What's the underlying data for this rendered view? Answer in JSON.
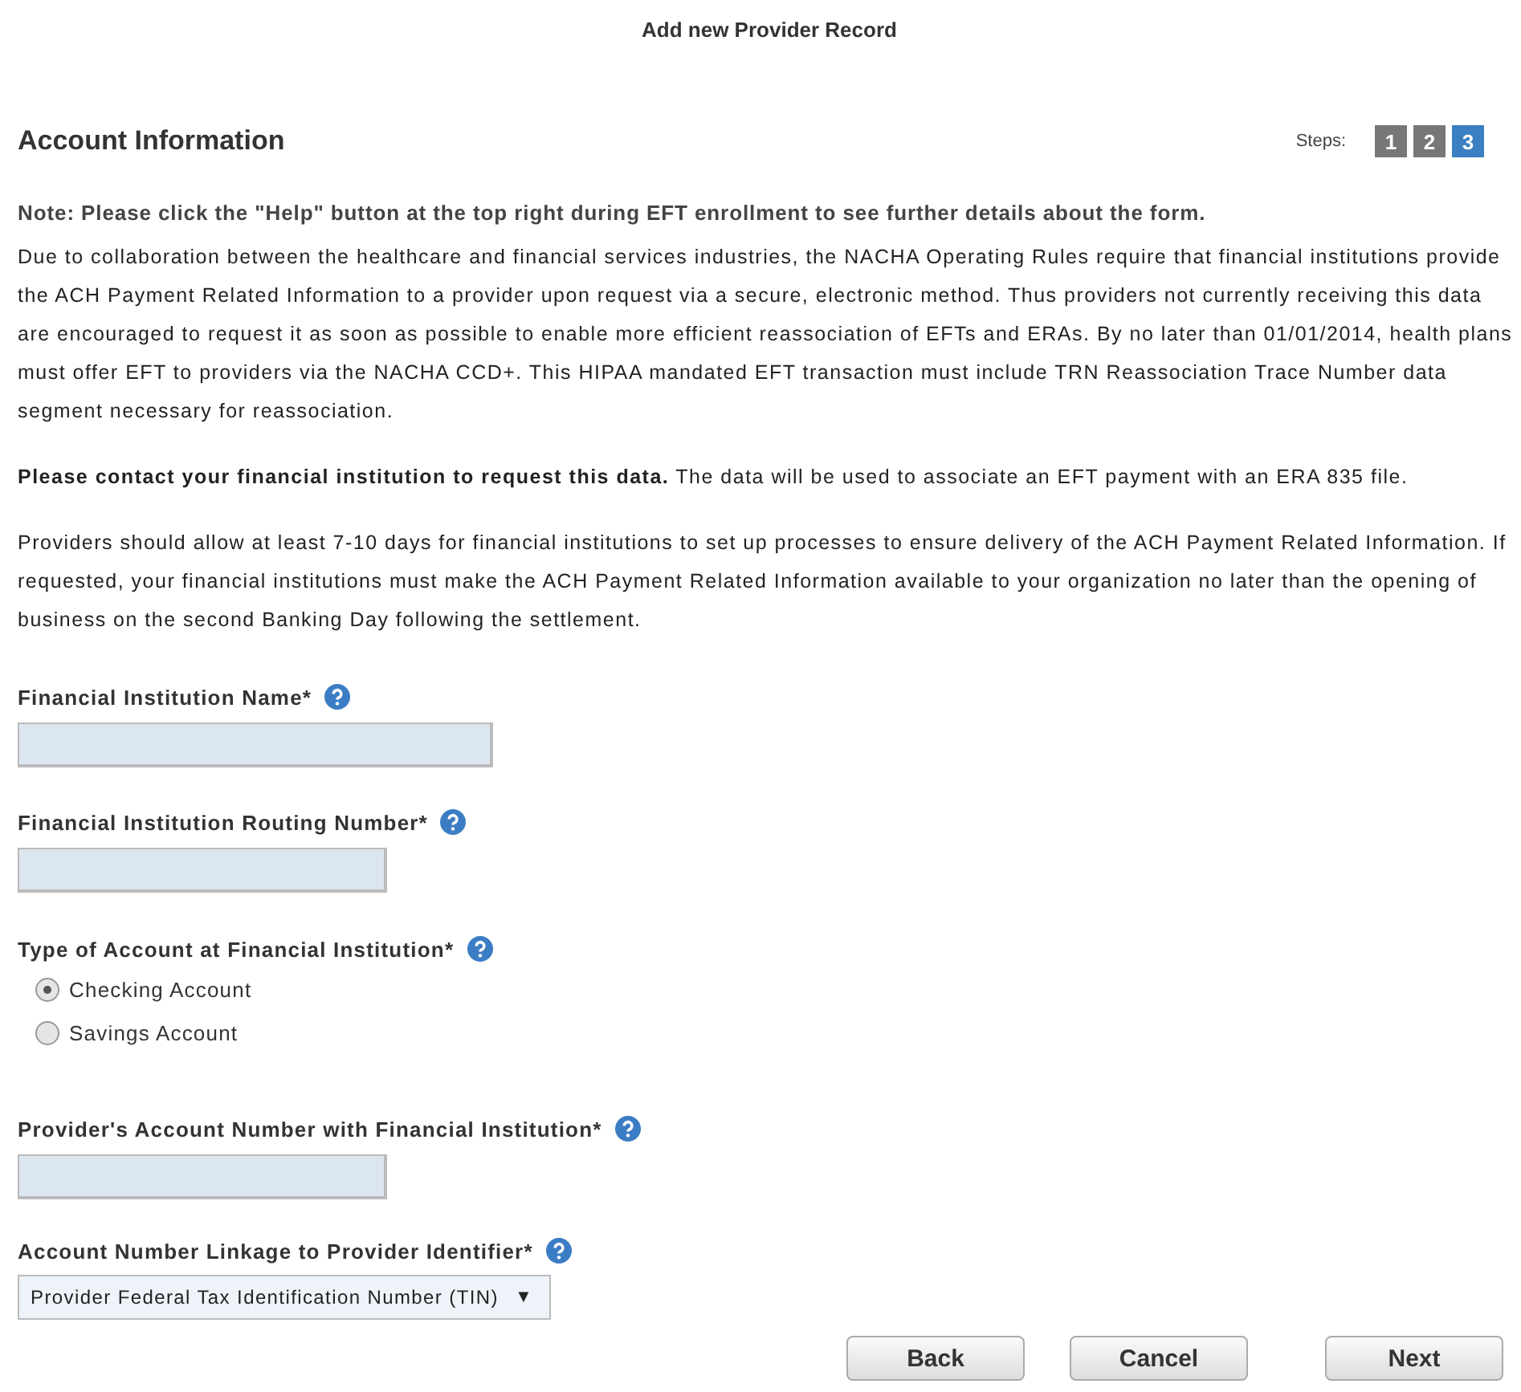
{
  "page_title": "Add new Provider Record",
  "section_title": "Account Information",
  "steps": {
    "label": "Steps:",
    "items": [
      {
        "label": "1",
        "selected": false
      },
      {
        "label": "2",
        "selected": false
      },
      {
        "label": "3",
        "selected": true
      }
    ]
  },
  "note": "Note: Please click the \"Help\" button at the top right during EFT enrollment to see further details about the form.",
  "paragraphs": [
    "Due to collaboration between the healthcare and financial services industries, the NACHA Operating Rules require that financial institutions provide the ACH Payment Related Information to a provider upon request via a secure, electronic method. Thus providers not currently receiving this data are encouraged to request it as soon as possible to enable more efficient reassociation of EFTs and ERAs. By no later than 01/01/2014, health plans must offer EFT to providers via the NACHA CCD+. This HIPAA mandated EFT transaction must include TRN Reassociation Trace Number data segment necessary for reassociation.",
    "**Please contact your financial institution to request this data.** The data will be used to associate an EFT payment with an ERA 835 file.",
    "Providers should allow at least 7-10 days for financial institutions to set up processes to ensure delivery of the ACH Payment Related Information. If requested, your financial institutions must make the ACH Payment Related Information available to your organization no later than the opening of business on the second Banking Day following the settlement."
  ],
  "fields": [
    {
      "kind": "text",
      "label": "Financial Institution Name*"
    },
    {
      "kind": "text",
      "label": "Financial Institution Routing Number*"
    },
    {
      "kind": "radio",
      "label": "Type of Account at Financial Institution*",
      "options": [
        {
          "label": "Checking Account",
          "selected": true
        },
        {
          "label": "Savings Account",
          "selected": false
        }
      ]
    },
    {
      "kind": "text",
      "label": "Provider's Account Number with Financial Institution*"
    },
    {
      "kind": "select",
      "label": "Account Number Linkage to Provider Identifier*",
      "value": "Provider Federal Tax Identification Number (TIN)",
      "arrow": "▼"
    }
  ],
  "buttons": [
    "Back",
    "Cancel",
    "Next"
  ]
}
